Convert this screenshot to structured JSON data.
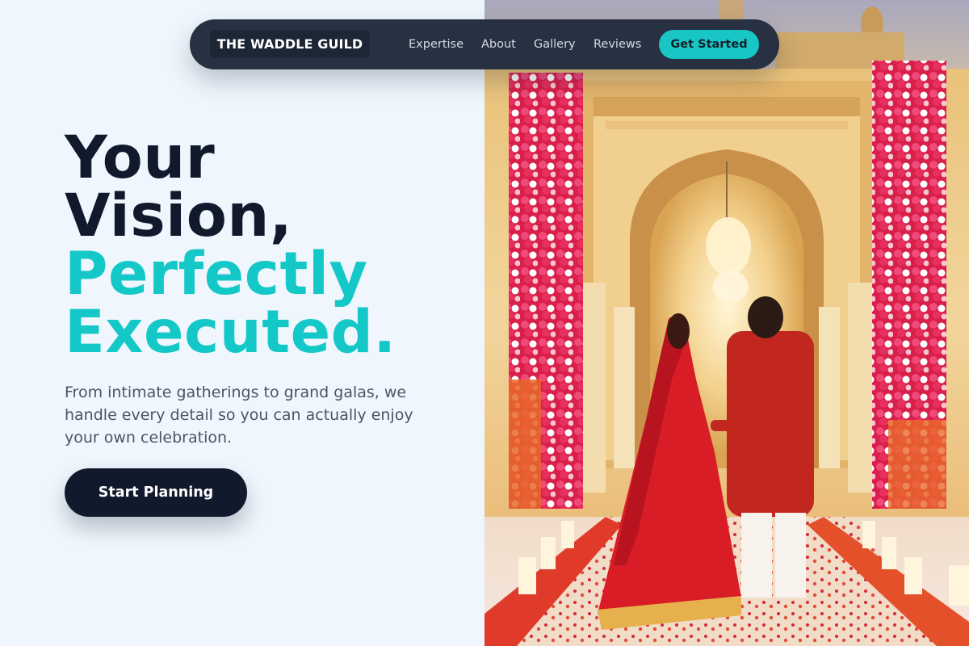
{
  "nav": {
    "brand": "THE WADDLE GUILD",
    "links": [
      "Expertise",
      "About",
      "Gallery",
      "Reviews"
    ],
    "cta_label": "Get Started"
  },
  "hero": {
    "headline": {
      "line1": "Your",
      "line2": "Vision,",
      "line3": "Perfectly",
      "line4": "Executed."
    },
    "subtitle": "From intimate gatherings to grand galas, we handle every detail so you can actually enjoy your own celebration.",
    "primary_button": "Start Planning",
    "image_icon": "wedding-couple-photo"
  },
  "colors": {
    "background": "#eff6fd",
    "navbar": "#273142",
    "accent": "#14c8c8",
    "dark_text": "#111a2c",
    "body_text": "#4a5564"
  }
}
